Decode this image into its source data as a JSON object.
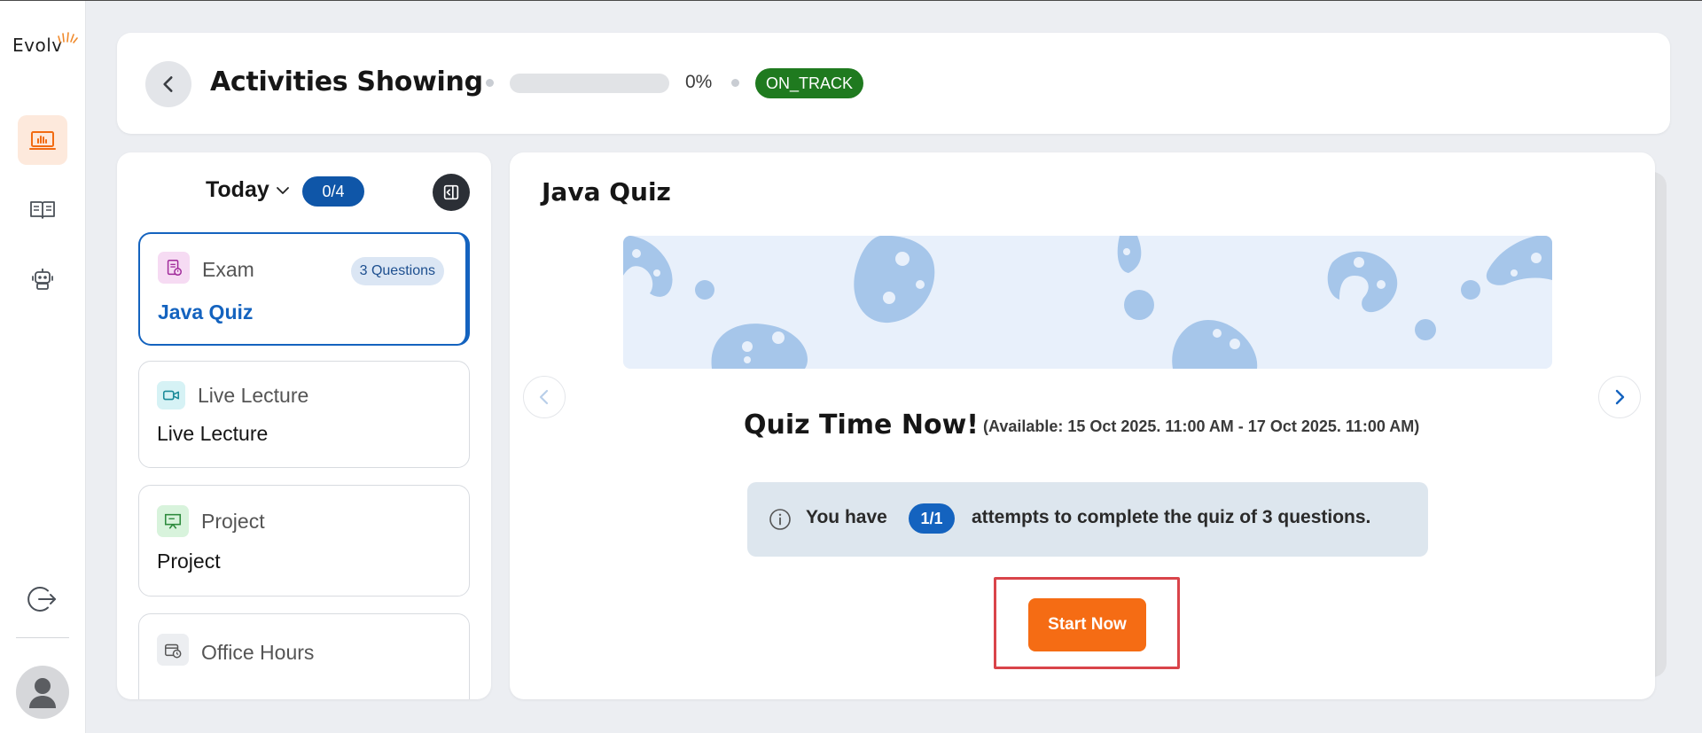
{
  "app": {
    "logo_text": "Evolv"
  },
  "sidebar": {
    "items": [
      {
        "name": "dashboard",
        "icon": "chart-screen-icon",
        "active": true
      },
      {
        "name": "courses",
        "icon": "book-icon",
        "active": false
      },
      {
        "name": "assistant",
        "icon": "robot-icon",
        "active": false
      }
    ],
    "logout_icon": "logout-icon",
    "avatar_icon": "user-avatar-icon"
  },
  "header": {
    "title": "Activities Showing",
    "progress_percent": 0,
    "progress_label": "0%",
    "status": "ON_TRACK",
    "status_color": "#1f7a1f"
  },
  "activities": {
    "day_label": "Today",
    "count": "0/4",
    "items": [
      {
        "type": "Exam",
        "name": "Java Quiz",
        "badge": "3 Questions",
        "selected": true,
        "icon": "exam-icon"
      },
      {
        "type": "Live Lecture",
        "name": "Live Lecture",
        "selected": false,
        "icon": "video-icon"
      },
      {
        "type": "Project",
        "name": "Project",
        "selected": false,
        "icon": "presentation-icon"
      },
      {
        "type": "Office Hours",
        "name": "",
        "selected": false,
        "icon": "calendar-clock-icon"
      }
    ]
  },
  "main": {
    "title": "Java Quiz",
    "heading": "Quiz Time Now!",
    "availability": "(Available: 15 Oct 2025. 11:00 AM - 17 Oct 2025. 11:00 AM)",
    "info_prefix": "You have",
    "attempts": "1/1",
    "info_suffix": "attempts to complete the quiz of 3 questions.",
    "start_label": "Start Now",
    "accent_color": "#f56c14"
  }
}
